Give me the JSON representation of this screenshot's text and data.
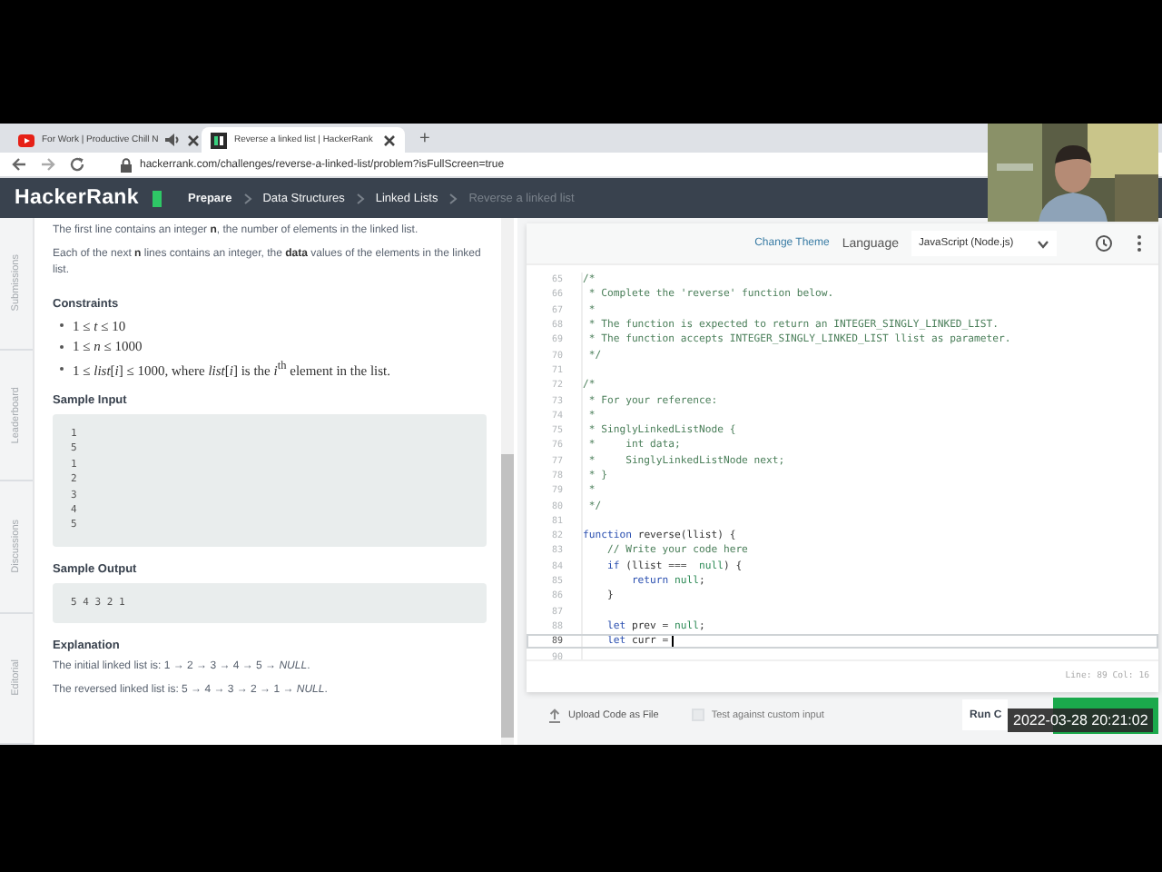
{
  "browser": {
    "tabs": [
      {
        "title": "For Work | Productive Chill N",
        "selected": false,
        "audio": true
      },
      {
        "title": "Reverse a linked list | HackerRank",
        "selected": true,
        "audio": false
      }
    ],
    "new_tab": "+",
    "url": "hackerrank.com/challenges/reverse-a-linked-list/problem?isFullScreen=true"
  },
  "nav": {
    "logo": "HackerRank",
    "breadcrumbs": [
      {
        "label": "Prepare",
        "current": false,
        "strong": true
      },
      {
        "label": "Data Structures",
        "current": false,
        "strong": false
      },
      {
        "label": "Linked Lists",
        "current": false,
        "strong": false
      },
      {
        "label": "Reverse a linked list",
        "current": true,
        "strong": false
      }
    ]
  },
  "side_tabs": [
    "Submissions",
    "Leaderboard",
    "Discussions",
    "Editorial"
  ],
  "problem": {
    "blocks": [
      {
        "kind": "paragraph",
        "text": "The first line contains an integer **n**, the number of elements in the linked list."
      },
      {
        "kind": "paragraph",
        "text": "Each of the next **n** lines contains an integer, the **data** values of the elements in the linked list."
      },
      {
        "kind": "heading",
        "text": "Constraints"
      },
      {
        "kind": "bullets",
        "items": [
          "1 ≤ *t* ≤ 10",
          "1 ≤ *n* ≤ 1000",
          "1 ≤ *list*[*i*] ≤ 1000, where *list*[*i*] is the *i*$^{th}$ element in the list."
        ]
      },
      {
        "kind": "heading",
        "text": "Sample Input"
      },
      {
        "kind": "code",
        "lines": [
          "1",
          "5",
          "1",
          "2",
          "3",
          "4",
          "5"
        ]
      },
      {
        "kind": "heading",
        "text": "Sample Output"
      },
      {
        "kind": "code",
        "lines": [
          "5 4 3 2 1"
        ]
      },
      {
        "kind": "heading",
        "text": "Explanation"
      },
      {
        "kind": "paragraph",
        "text": "The initial linked list is: 1 → 2 → 3 → 4 → 5 → *NULL*."
      },
      {
        "kind": "paragraph",
        "text": "The reversed linked list is: 5 → 4 → 3 → 2 → 1 → *NULL*."
      }
    ]
  },
  "editor": {
    "change_theme": "Change Theme",
    "language_label": "Language",
    "language": "JavaScript (Node.js)",
    "lines": [
      {
        "number": "65",
        "current": false,
        "tokens": [
          {
            "text": "/*",
            "kind": "comment"
          }
        ]
      },
      {
        "number": "66",
        "current": false,
        "tokens": [
          {
            "text": " * Complete the 'reverse' function below.",
            "kind": "comment"
          }
        ]
      },
      {
        "number": "67",
        "current": false,
        "tokens": [
          {
            "text": " *",
            "kind": "comment"
          }
        ]
      },
      {
        "number": "68",
        "current": false,
        "tokens": [
          {
            "text": " * The function is expected to return an INTEGER_SINGLY_LINKED_LIST.",
            "kind": "comment"
          }
        ]
      },
      {
        "number": "69",
        "current": false,
        "tokens": [
          {
            "text": " * The function accepts INTEGER_SINGLY_LINKED_LIST llist as parameter.",
            "kind": "comment"
          }
        ]
      },
      {
        "number": "70",
        "current": false,
        "tokens": [
          {
            "text": " */",
            "kind": "comment"
          }
        ]
      },
      {
        "number": "71",
        "current": false
      },
      {
        "number": "72",
        "current": false,
        "tokens": [
          {
            "text": "/*",
            "kind": "comment"
          }
        ]
      },
      {
        "number": "73",
        "current": false,
        "tokens": [
          {
            "text": " * For your reference:",
            "kind": "comment"
          }
        ]
      },
      {
        "number": "74",
        "current": false,
        "tokens": [
          {
            "text": " *",
            "kind": "comment"
          }
        ]
      },
      {
        "number": "75",
        "current": false,
        "tokens": [
          {
            "text": " * SinglyLinkedListNode {",
            "kind": "comment"
          }
        ]
      },
      {
        "number": "76",
        "current": false,
        "tokens": [
          {
            "text": " *     int data;",
            "kind": "comment"
          }
        ]
      },
      {
        "number": "77",
        "current": false,
        "tokens": [
          {
            "text": " *     SinglyLinkedListNode next;",
            "kind": "comment"
          }
        ]
      },
      {
        "number": "78",
        "current": false,
        "tokens": [
          {
            "text": " * }",
            "kind": "comment"
          }
        ]
      },
      {
        "number": "79",
        "current": false,
        "tokens": [
          {
            "text": " *",
            "kind": "comment"
          }
        ]
      },
      {
        "number": "80",
        "current": false,
        "tokens": [
          {
            "text": " */",
            "kind": "comment"
          }
        ]
      },
      {
        "number": "81",
        "current": false
      },
      {
        "number": "82",
        "current": false,
        "tokens": [
          {
            "text": "function",
            "kind": "keyword"
          },
          {
            "text": " reverse(llist) {",
            "kind": "plain"
          }
        ]
      },
      {
        "number": "83",
        "current": false,
        "tokens": [
          {
            "text": "    // Write your code here",
            "kind": "comment"
          }
        ]
      },
      {
        "number": "84",
        "current": false,
        "tokens": [
          {
            "text": "    if",
            "kind": "keyword"
          },
          {
            "text": " (llist ===  ",
            "kind": "plain"
          },
          {
            "text": "null",
            "kind": "literal"
          },
          {
            "text": ") {",
            "kind": "plain"
          }
        ]
      },
      {
        "number": "85",
        "current": false,
        "tokens": [
          {
            "text": "        return",
            "kind": "keyword"
          },
          {
            "text": " null",
            "kind": "literal"
          },
          {
            "text": ";",
            "kind": "plain"
          }
        ]
      },
      {
        "number": "86",
        "current": false,
        "tokens": [
          {
            "text": "    }",
            "kind": "plain"
          }
        ]
      },
      {
        "number": "87",
        "current": false
      },
      {
        "number": "88",
        "current": false,
        "tokens": [
          {
            "text": "    let",
            "kind": "keyword"
          },
          {
            "text": " prev = ",
            "kind": "plain"
          },
          {
            "text": "null",
            "kind": "literal"
          },
          {
            "text": ";",
            "kind": "plain"
          }
        ]
      },
      {
        "number": "89",
        "current": true,
        "tokens": [
          {
            "text": "    let",
            "kind": "keyword"
          },
          {
            "text": " curr =",
            "kind": "plain"
          }
        ]
      },
      {
        "number": "90",
        "current": false
      }
    ],
    "status": "Line: 89 Col: 16"
  },
  "footer": {
    "upload": "Upload Code as File",
    "custom_input": {
      "label": "Test against custom input",
      "checked": false
    },
    "run": "Run C"
  },
  "overlay": {
    "timestamp": "2022-03-28 20:21:02"
  }
}
